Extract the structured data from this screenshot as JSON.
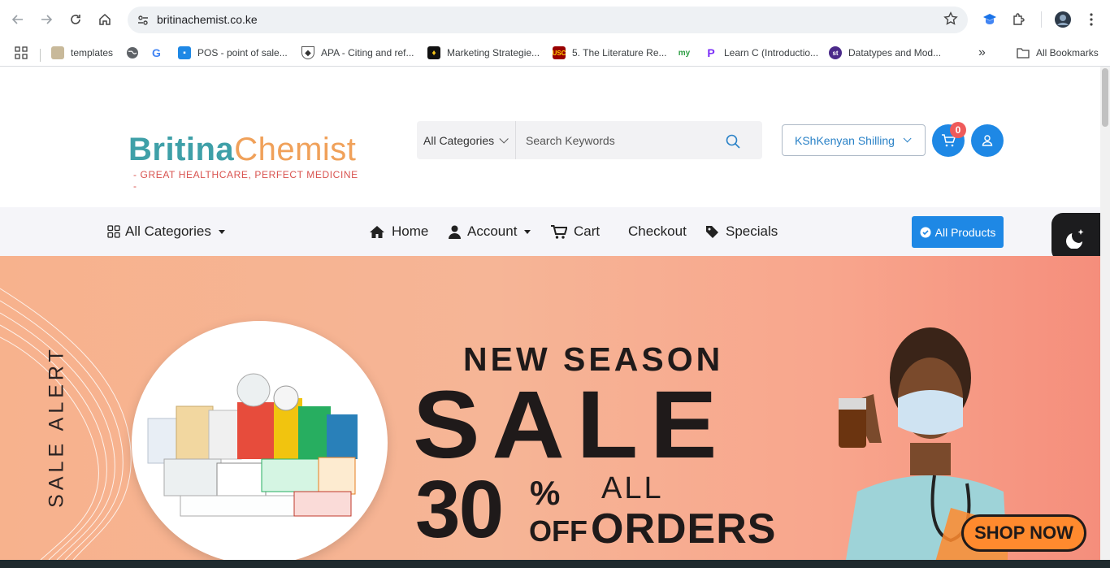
{
  "browser": {
    "url": "britinachemist.co.ke",
    "bookmarks": [
      {
        "label": "templates"
      },
      {
        "label": ""
      },
      {
        "label": ""
      },
      {
        "label": "POS - point of sale..."
      },
      {
        "label": "APA - Citing and ref..."
      },
      {
        "label": "Marketing Strategie..."
      },
      {
        "label": "5. The Literature Re..."
      },
      {
        "label": ""
      },
      {
        "label": "Learn C (Introductio..."
      },
      {
        "label": "Datatypes and Mod..."
      }
    ],
    "all_bookmarks": "All Bookmarks",
    "more_chevron": "»"
  },
  "header": {
    "logo_part1": "Britina",
    "logo_part2": "Chemist",
    "tagline": "- GREAT HEALTHCARE, PERFECT MEDICINE -",
    "search_category": "All Categories",
    "search_placeholder": "Search Keywords",
    "currency": "KShKenyan Shilling",
    "cart_count": "0"
  },
  "nav": {
    "all_categories": "All Categories",
    "home": "Home",
    "account": "Account",
    "cart": "Cart",
    "checkout": "Checkout",
    "specials": "Specials",
    "all_products": "All Products"
  },
  "banner": {
    "side_text": "SALE ALERT",
    "new_season": "NEW SEASON",
    "sale": "SALE",
    "discount": "30",
    "percent": "%",
    "off": "OFF",
    "all": "ALL",
    "orders": "ORDERS",
    "cta": "SHOP NOW"
  },
  "colors": {
    "brand_teal": "#3fa0a8",
    "brand_orange": "#f0a15a",
    "accent_blue": "#1e88e5",
    "badge_red": "#ef5b5b"
  }
}
